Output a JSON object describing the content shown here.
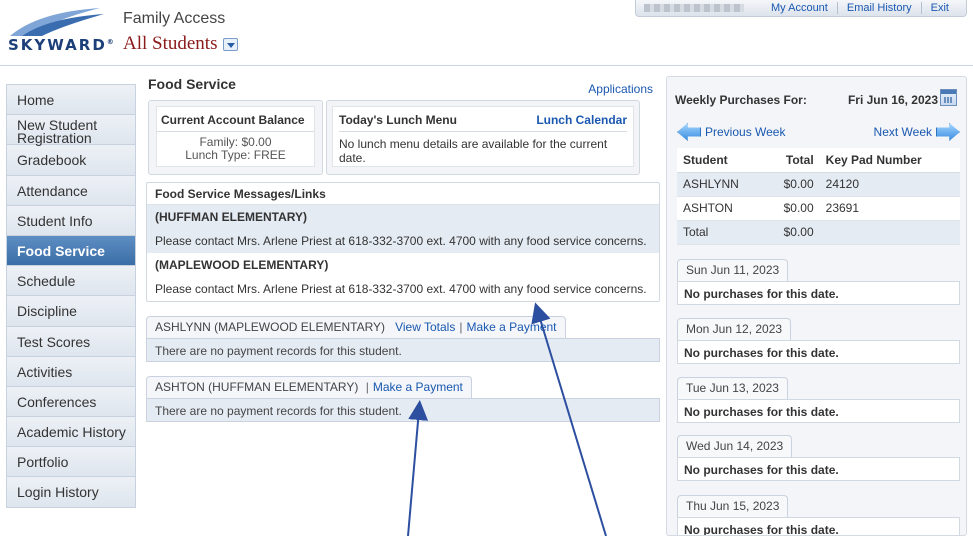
{
  "header": {
    "logo_text": "SKYWARD",
    "app_title": "Family Access",
    "student_filter": "All Students",
    "top_links": [
      "My Account",
      "Email History",
      "Exit"
    ]
  },
  "nav": {
    "items": [
      {
        "label": "Home"
      },
      {
        "label": "New Student Registration"
      },
      {
        "label": "Gradebook"
      },
      {
        "label": "Attendance"
      },
      {
        "label": "Student Info"
      },
      {
        "label": "Food Service",
        "active": true
      },
      {
        "label": "Schedule"
      },
      {
        "label": "Discipline"
      },
      {
        "label": "Test Scores"
      },
      {
        "label": "Activities"
      },
      {
        "label": "Conferences"
      },
      {
        "label": "Academic History"
      },
      {
        "label": "Portfolio"
      },
      {
        "label": "Login History"
      }
    ]
  },
  "main": {
    "title": "Food Service",
    "applications_link": "Applications",
    "balance": {
      "title": "Current Account Balance",
      "family_label": "Family:",
      "family_value": "$0.00",
      "lunch_label": "Lunch Type:",
      "lunch_value": "FREE"
    },
    "menu": {
      "title": "Today's Lunch Menu",
      "calendar_link": "Lunch Calendar",
      "text": "No lunch menu details are available for the current date."
    },
    "messages": {
      "title": "Food Service Messages/Links",
      "rows": [
        "(HUFFMAN ELEMENTARY)",
        "Please contact Mrs. Arlene Priest at 618-332-3700 ext. 4700 with any food service concerns.",
        "(MAPLEWOOD ELEMENTARY)",
        "Please contact Mrs. Arlene Priest at 618-332-3700 ext. 4700 with any food service concerns."
      ]
    },
    "students": [
      {
        "name": "ASHLYNN (MAPLEWOOD ELEMENTARY)",
        "view_totals": "View Totals",
        "sep": "|",
        "payment": "Make a Payment",
        "records": "There are no payment records for this student."
      },
      {
        "name": "ASHTON (HUFFMAN ELEMENTARY)",
        "sep": "|",
        "payment": "Make a Payment",
        "records": "There are no payment records for this student."
      }
    ]
  },
  "weekly": {
    "title": "Weekly Purchases For:",
    "date": "Fri Jun 16, 2023",
    "prev": "Previous Week",
    "next": "Next Week",
    "columns": [
      "Student",
      "Total",
      "Key Pad Number"
    ],
    "rows": [
      [
        "ASHLYNN",
        "$0.00",
        "24120"
      ],
      [
        "ASHTON",
        "$0.00",
        "23691"
      ],
      [
        "Total",
        "$0.00",
        ""
      ]
    ],
    "days": [
      {
        "date": "Sun Jun 11, 2023",
        "text": "No purchases for this date."
      },
      {
        "date": "Mon Jun 12, 2023",
        "text": "No purchases for this date."
      },
      {
        "date": "Tue Jun 13, 2023",
        "text": "No purchases for this date."
      },
      {
        "date": "Wed Jun 14, 2023",
        "text": "No purchases for this date."
      },
      {
        "date": "Thu Jun 15, 2023",
        "text": "No purchases for this date."
      }
    ]
  },
  "colors": {
    "link": "#1a58b0",
    "nav_active": "#4677b0",
    "student_filter": "#8b1a1a",
    "annotation": "#2d4fa0"
  }
}
